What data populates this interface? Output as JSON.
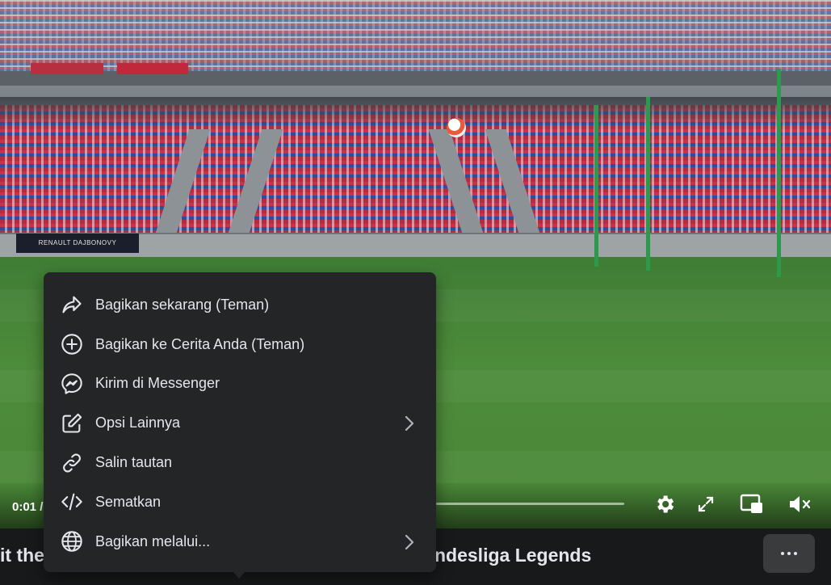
{
  "video": {
    "current_time": "0:01 /",
    "ad_board_text": "RENAULT DAJBONOVY"
  },
  "share_menu": {
    "items": [
      {
        "label": "Bagikan sekarang (Teman)",
        "icon": "share-arrow-icon",
        "has_submenu": false
      },
      {
        "label": "Bagikan ke Cerita Anda (Teman)",
        "icon": "plus-circle-icon",
        "has_submenu": false
      },
      {
        "label": "Kirim di Messenger",
        "icon": "messenger-icon",
        "has_submenu": false
      },
      {
        "label": "Opsi Lainnya",
        "icon": "edit-icon",
        "has_submenu": true
      },
      {
        "label": "Salin tautan",
        "icon": "link-icon",
        "has_submenu": false
      },
      {
        "label": "Sematkan",
        "icon": "embed-code-icon",
        "has_submenu": false
      },
      {
        "label": "Bagikan melalui...",
        "icon": "globe-icon",
        "has_submenu": true
      }
    ]
  },
  "post": {
    "title_left_fragment": "it the",
    "title_right_fragment": "ndesliga Legends",
    "more_button": "more-options"
  },
  "colors": {
    "menu_bg": "#242526",
    "text_primary": "#e4e6eb",
    "page_bg": "#18191a",
    "button_bg": "#3a3b3c"
  }
}
